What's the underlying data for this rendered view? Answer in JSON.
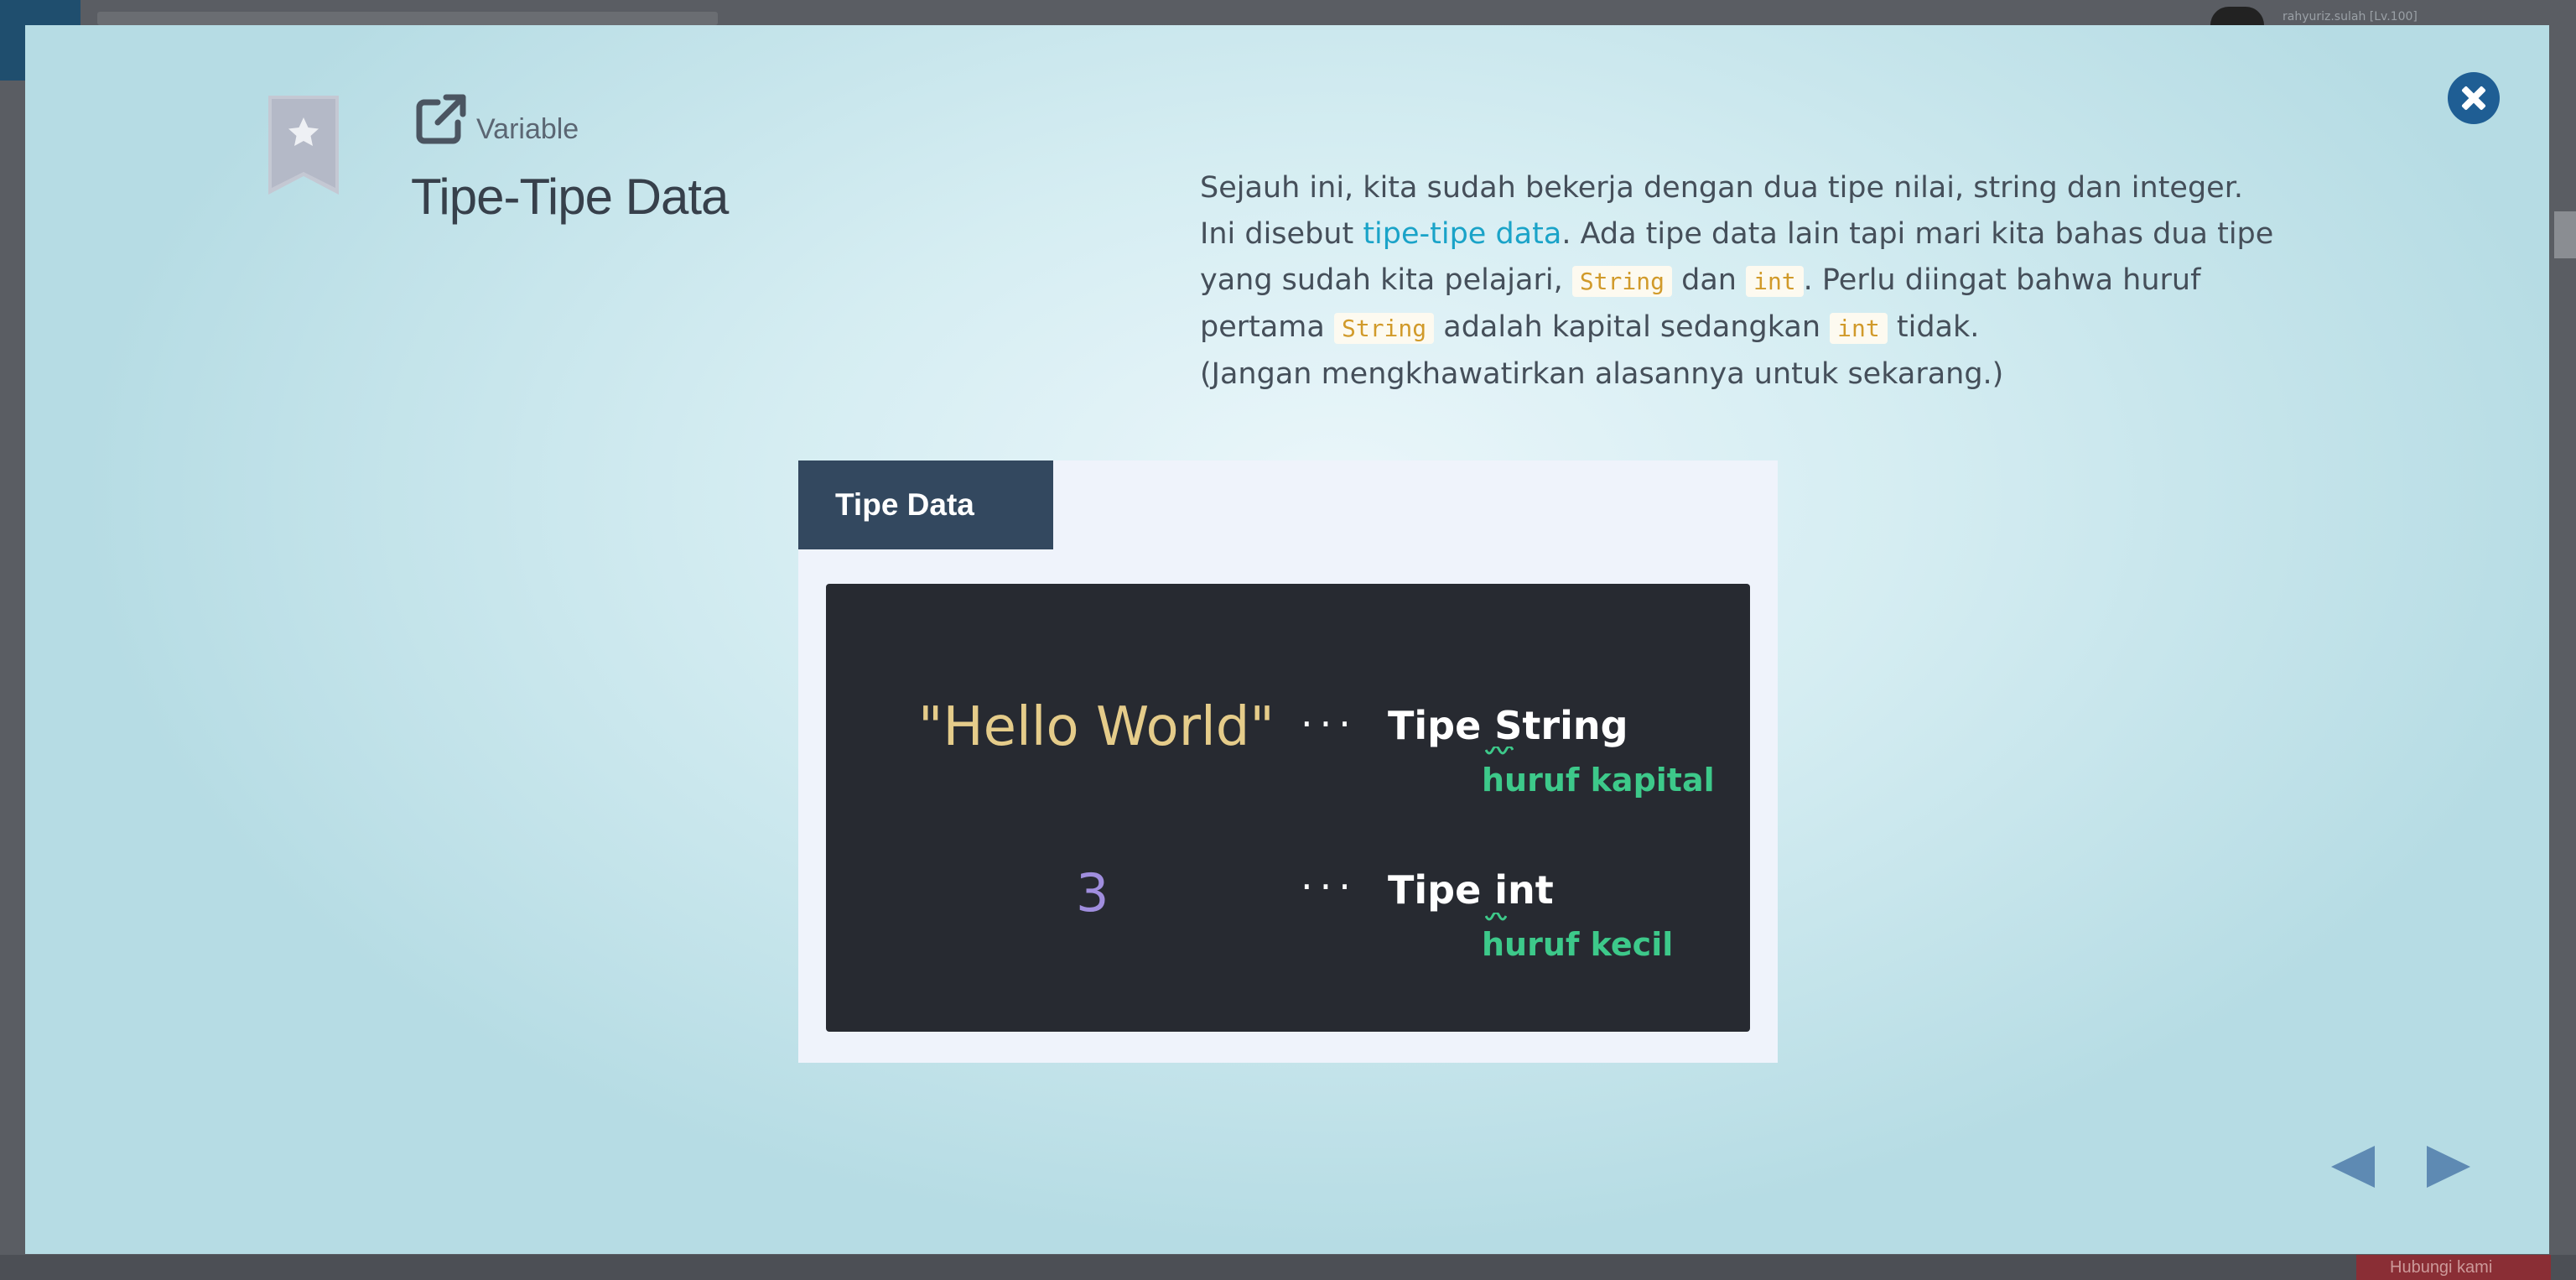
{
  "background": {
    "user_label": "rahyuriz.sulah [Lv.100]",
    "bottom_button": "Hubungi kami"
  },
  "modal": {
    "breadcrumb": "Variable",
    "title": "Tipe-Tipe Data",
    "description": {
      "line1": "Sejauh ini, kita sudah bekerja dengan dua tipe nilai, string dan integer.",
      "p2_pre": "Ini disebut ",
      "p2_link": "tipe-tipe data",
      "p2_mid": ". Ada tipe data lain tapi mari kita bahas dua tipe yang sudah kita pelajari, ",
      "code_string": "String",
      "p2_dan": " dan ",
      "code_int": "int",
      "p2_post": ". Perlu diingat bahwa huruf pertama ",
      "p2_adalah": " adalah kapital sedangkan ",
      "p2_end": " tidak.",
      "p3": "(Jangan mengkhawatirkan alasannya untuk sekarang.)"
    },
    "card": {
      "tab_label": "Tipe Data",
      "string_value": "\"Hello World\"",
      "dots": "···",
      "string_type": "Tipe String",
      "string_note": "huruf kapital",
      "int_value": "3",
      "int_type": "Tipe int",
      "int_note": "huruf kecil"
    }
  },
  "colors": {
    "accent_link": "#1aa3c8",
    "close_button": "#1f5e94",
    "card_tab": "#33485f",
    "panel_bg": "#272a31",
    "note_green": "#3dc98a"
  },
  "icons": {
    "bookmark": "bookmark-star-icon",
    "external": "external-link-icon",
    "close": "close-icon",
    "prev": "prev-arrow-icon",
    "next": "next-arrow-icon"
  }
}
